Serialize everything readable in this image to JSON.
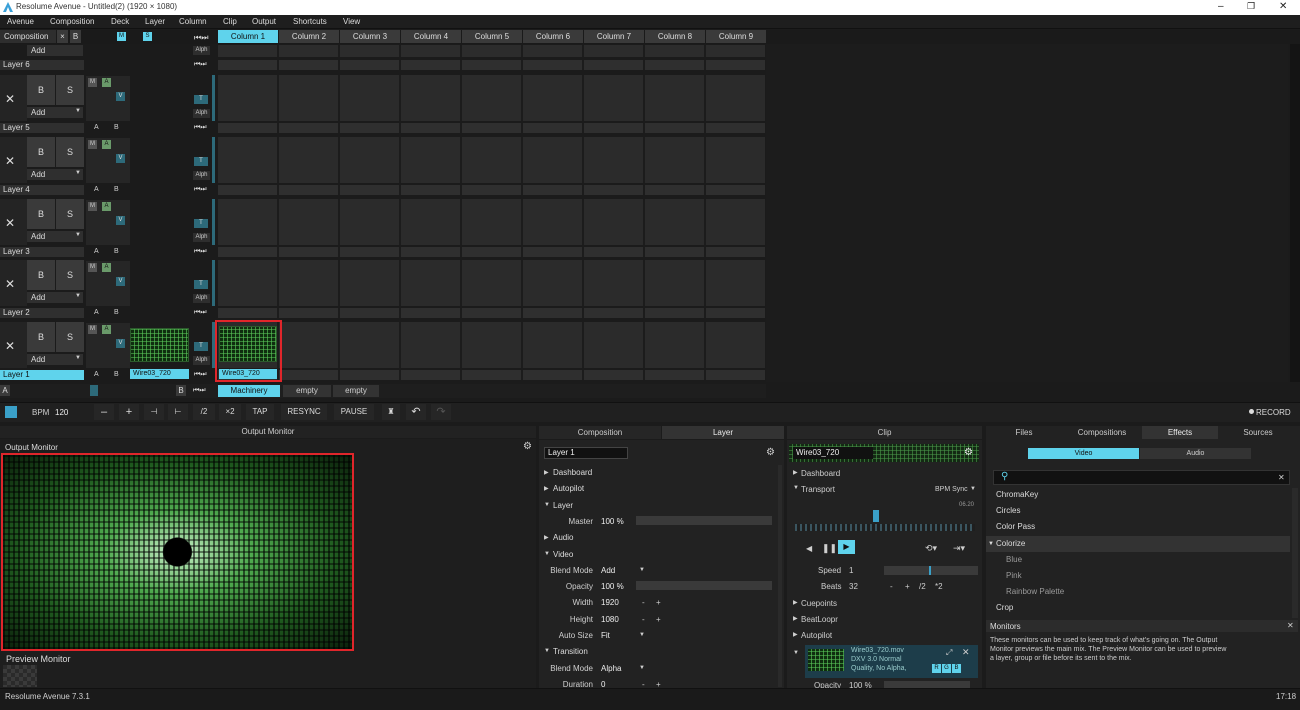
{
  "titlebar": {
    "title": "Resolume Avenue - Untitled(2) (1920 × 1080)",
    "minimize": "–",
    "maximize": "❐",
    "close": "✕"
  },
  "menu": [
    "Avenue",
    "Composition",
    "Deck",
    "Layer",
    "Column",
    "Clip",
    "Output",
    "Shortcuts",
    "View"
  ],
  "comp_bar": {
    "label": "Composition",
    "x": "×",
    "b": "B",
    "m": "M",
    "s": "S",
    "add": "Add",
    "alph": "Alph"
  },
  "columns": [
    "Column 1",
    "Column 2",
    "Column 3",
    "Column 4",
    "Column 5",
    "Column 6",
    "Column 7",
    "Column 8",
    "Column 9"
  ],
  "layers": [
    {
      "name": "Layer 6"
    },
    {
      "name": "Layer 5"
    },
    {
      "name": "Layer 4"
    },
    {
      "name": "Layer 3"
    },
    {
      "name": "Layer 2"
    },
    {
      "name": "Layer 1"
    }
  ],
  "layer_ctrl": {
    "x": "✕",
    "b": "B",
    "s": "S",
    "add": "Add",
    "m": "M",
    "a": "A",
    "v": "V",
    "t": "T",
    "alph": "Alph",
    "ab_a": "A",
    "ab_b": "B"
  },
  "clips": {
    "clip1_name": "Wire03_720",
    "clip2_name": "Wire03_720"
  },
  "deck": {
    "a": "A",
    "b": "B",
    "tabs": [
      "Machinery",
      "empty",
      "empty"
    ]
  },
  "transport": {
    "bpm_label": "BPM",
    "bpm": "120",
    "minus": "–",
    "plus": "+",
    "nudge_l": "⊣",
    "nudge_r": "⊢",
    "half": "/2",
    "double": "×2",
    "tap": "TAP",
    "resync": "RESYNC",
    "pause": "PAUSE",
    "record": "RECORD"
  },
  "output_monitor": {
    "header": "Output Monitor",
    "title": "Output Monitor",
    "preview": "Preview Monitor"
  },
  "comp_panel": {
    "tab_comp": "Composition",
    "tab_layer": "Layer",
    "layer_name": "Layer 1",
    "rows": [
      {
        "type": "group",
        "label": "Dashboard",
        "open": false
      },
      {
        "type": "group",
        "label": "Autopilot",
        "open": false
      },
      {
        "type": "group",
        "label": "Layer",
        "open": true
      },
      {
        "type": "param",
        "label": "Master",
        "value": "100 %",
        "slider": true
      },
      {
        "type": "group",
        "label": "Audio",
        "open": false
      },
      {
        "type": "group",
        "label": "Video",
        "open": true
      },
      {
        "type": "param",
        "label": "Blend Mode",
        "value": "Add",
        "dropdown": true
      },
      {
        "type": "param",
        "label": "Opacity",
        "value": "100 %",
        "slider": true
      },
      {
        "type": "param",
        "label": "Width",
        "value": "1920",
        "pm": true
      },
      {
        "type": "param",
        "label": "Height",
        "value": "1080",
        "pm": true
      },
      {
        "type": "param",
        "label": "Auto Size",
        "value": "Fit",
        "dropdown": true
      },
      {
        "type": "group",
        "label": "Transition",
        "open": true
      },
      {
        "type": "param",
        "label": "Blend Mode",
        "value": "Alpha",
        "dropdown": true
      },
      {
        "type": "param",
        "label": "Duration",
        "value": "0",
        "pm": true
      }
    ]
  },
  "clip_panel": {
    "tab": "Clip",
    "clip_name": "Wire03_720",
    "dashboard": "Dashboard",
    "transport": "Transport",
    "bpm_sync": "BPM Sync",
    "time": "06.20",
    "speed_label": "Speed",
    "speed_val": "1",
    "beats_label": "Beats",
    "beats_val": "32",
    "beats_ops": [
      "-",
      "+",
      "/2",
      "*2"
    ],
    "cuepoints": "Cuepoints",
    "beatloopr": "BeatLoopr",
    "autopilot": "Autopilot",
    "file_name": "Wire03_720.mov",
    "file_info1": "DXV 3.0 Normal",
    "file_info2": "Quality, No Alpha,",
    "rgb": [
      "R",
      "G",
      "B"
    ],
    "opacity_label": "Opacity",
    "opacity_val": "100 %"
  },
  "browser": {
    "tabs": [
      "Files",
      "Compositions",
      "Effects",
      "Sources"
    ],
    "sub_video": "Video",
    "sub_audio": "Audio",
    "search_placeholder": "",
    "items": [
      {
        "label": "ChromaKey",
        "sub": false
      },
      {
        "label": "Circles",
        "sub": false
      },
      {
        "label": "Color Pass",
        "sub": false
      },
      {
        "label": "Colorize",
        "sub": false,
        "open": true
      },
      {
        "label": "Blue",
        "sub": true
      },
      {
        "label": "Pink",
        "sub": true
      },
      {
        "label": "Rainbow Palette",
        "sub": true
      },
      {
        "label": "Crop",
        "sub": false
      }
    ]
  },
  "monitors_help": {
    "title": "Monitors",
    "text": "These monitors can be used to keep track of what's going on. The Output Monitor previews the main mix. The Preview Monitor can be used to preview a layer, group or file before its sent to the mix."
  },
  "status": {
    "version": "Resolume Avenue 7.3.1",
    "time": "17:18"
  },
  "colors": {
    "accent": "#5fd3ec",
    "highlight": "#e0262b",
    "green": "#3d8f3d"
  }
}
